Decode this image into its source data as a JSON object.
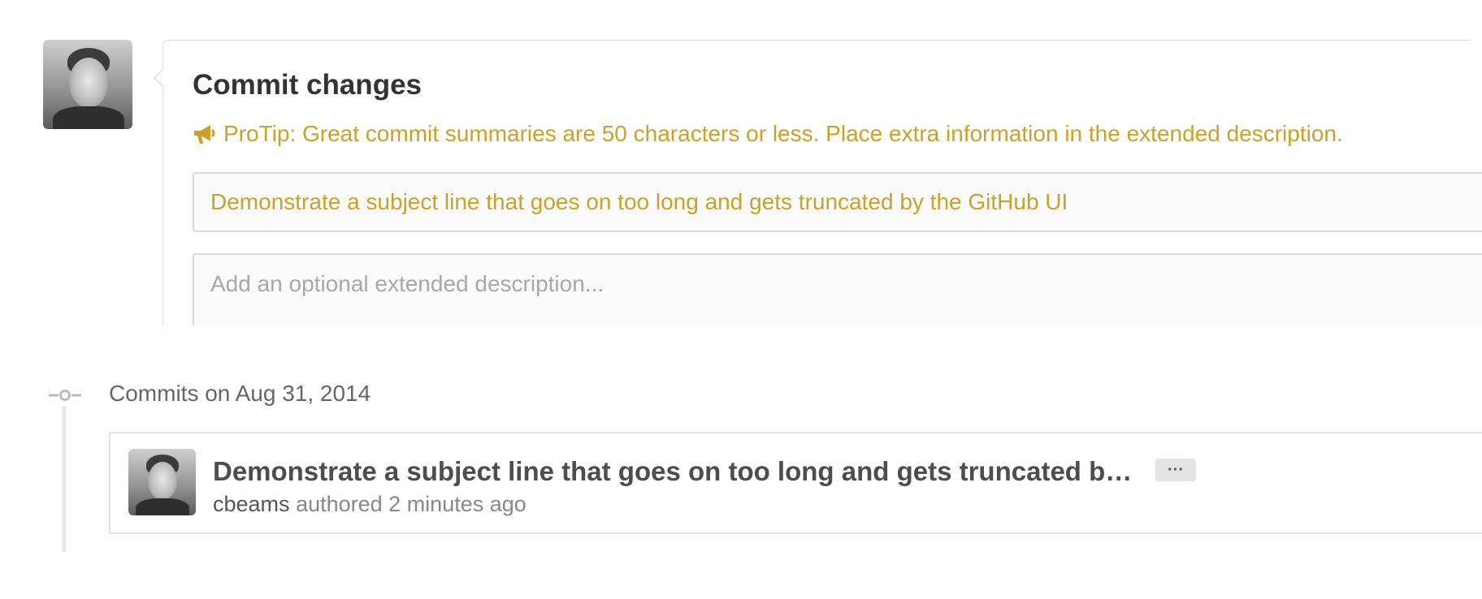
{
  "commit_form": {
    "title": "Commit changes",
    "protip": "ProTip: Great commit summaries are 50 characters or less. Place extra information in the extended description.",
    "summary_value": "Demonstrate a subject line that goes on too long and gets truncated by the GitHub UI",
    "description_placeholder": "Add an optional extended description..."
  },
  "timeline": {
    "date_heading": "Commits on Aug 31, 2014",
    "commits": [
      {
        "message": "Demonstrate a subject line that goes on too long and gets truncated b…",
        "expand_label": "···",
        "author": "cbeams",
        "authored_label": "authored",
        "time": "2 minutes ago"
      }
    ]
  },
  "colors": {
    "protip": "#c9a227",
    "border": "#dcdcdc",
    "timeline": "#e6e6e6"
  },
  "icons": {
    "protip": "megaphone-icon",
    "timeline_node": "commit-node-icon"
  }
}
